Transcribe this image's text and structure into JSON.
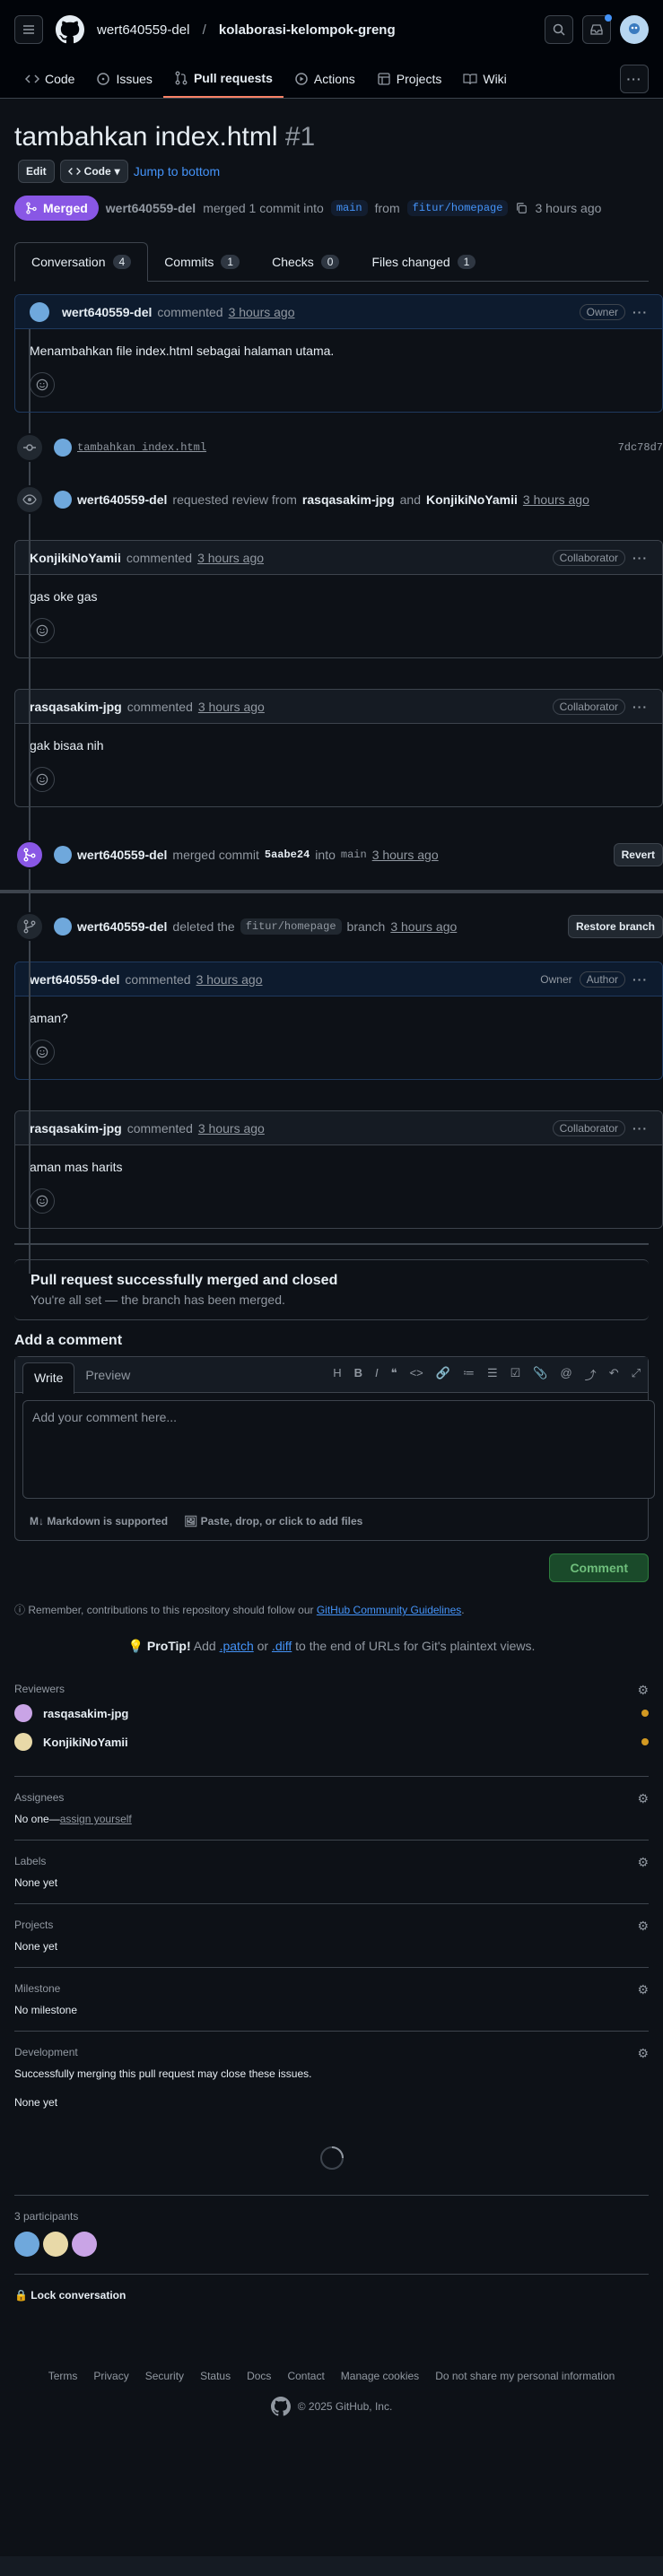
{
  "header": {
    "owner": "wert640559-del",
    "sep": "/",
    "repo": "kolaborasi-kelompok-greng"
  },
  "nav": [
    {
      "label": "Code",
      "icon": "code-icon"
    },
    {
      "label": "Issues",
      "icon": "issue-icon"
    },
    {
      "label": "Pull requests",
      "icon": "pull-request-icon",
      "active": true
    },
    {
      "label": "Actions",
      "icon": "play-icon"
    },
    {
      "label": "Projects",
      "icon": "table-icon"
    },
    {
      "label": "Wiki",
      "icon": "book-icon"
    }
  ],
  "pr": {
    "title": "tambahkan index.html",
    "number": "#1",
    "edit": "Edit",
    "code": "Code",
    "jump": "Jump to bottom",
    "state": "Merged",
    "author": "wert640559-del",
    "summary": "merged 1 commit into",
    "base": "main",
    "from": "from",
    "head": "fitur/homepage",
    "time": "3 hours ago"
  },
  "tabs": [
    {
      "label": "Conversation",
      "count": "4"
    },
    {
      "label": "Commits",
      "count": "1"
    },
    {
      "label": "Checks",
      "count": "0"
    },
    {
      "label": "Files changed",
      "count": "1"
    }
  ],
  "timeline": {
    "c1": {
      "author": "wert640559-del",
      "verb": "commented",
      "time": "3 hours ago",
      "label": "Owner",
      "body": "Menambahkan file index.html sebagai halaman utama."
    },
    "commit": {
      "msg": "tambahkan index.html",
      "sha": "7dc78d7"
    },
    "review": {
      "author": "wert640559-del",
      "text": "requested review from",
      "r1": "rasqasakim-jpg",
      "and": "and",
      "r2": "KonjikiNoYamii",
      "time": "3 hours ago"
    },
    "c2": {
      "author": "KonjikiNoYamii",
      "verb": "commented",
      "time": "3 hours ago",
      "label": "Collaborator",
      "body": "gas oke gas"
    },
    "c3": {
      "author": "rasqasakim-jpg",
      "verb": "commented",
      "time": "3 hours ago",
      "label": "Collaborator",
      "body": "gak bisaa nih"
    },
    "merge": {
      "author": "wert640559-del",
      "text": "merged commit",
      "sha": "5aabe24",
      "into": "into",
      "base": "main",
      "time": "3 hours ago",
      "btn": "Revert"
    },
    "del": {
      "author": "wert640559-del",
      "text": "deleted the",
      "branch": "fitur/homepage",
      "after": "branch",
      "time": "3 hours ago",
      "btn": "Restore branch"
    },
    "c4": {
      "author": "wert640559-del",
      "verb": "commented",
      "time": "3 hours ago",
      "label": "Owner",
      "label2": "Author",
      "body": "aman?"
    },
    "c5": {
      "author": "rasqasakim-jpg",
      "verb": "commented",
      "time": "3 hours ago",
      "label": "Collaborator",
      "body": "aman mas harits"
    }
  },
  "mergebox": {
    "title": "Pull request successfully merged and closed",
    "sub": "You're all set — the branch has been merged."
  },
  "composer": {
    "heading": "Add a comment",
    "write": "Write",
    "preview": "Preview",
    "placeholder": "Add your comment here...",
    "md": "Markdown is supported",
    "attach": "Paste, drop, or click to add files",
    "submit": "Comment"
  },
  "notice": {
    "text": "Remember, contributions to this repository should follow our",
    "link": "GitHub Community Guidelines",
    "end": "."
  },
  "protip": {
    "strong": "ProTip!",
    "a": "Add",
    "patch": ".patch",
    "or": "or",
    "diff": ".diff",
    "b": "to the end of URLs for Git's plaintext views."
  },
  "sidebar": {
    "reviewers": {
      "title": "Reviewers",
      "items": [
        "rasqasakim-jpg",
        "KonjikiNoYamii"
      ]
    },
    "assignees": {
      "title": "Assignees",
      "value": "No one—",
      "link": "assign yourself"
    },
    "labels": {
      "title": "Labels",
      "value": "None yet"
    },
    "projects": {
      "title": "Projects",
      "value": "None yet"
    },
    "milestone": {
      "title": "Milestone",
      "value": "No milestone"
    },
    "development": {
      "title": "Development",
      "desc": "Successfully merging this pull request may close these issues.",
      "value": "None yet"
    },
    "participants": {
      "title": "3 participants"
    },
    "lock": "Lock conversation"
  },
  "footer": {
    "links": [
      "Terms",
      "Privacy",
      "Security",
      "Status",
      "Docs",
      "Contact",
      "Manage cookies",
      "Do not share my personal information"
    ],
    "copy": "© 2025 GitHub, Inc."
  }
}
